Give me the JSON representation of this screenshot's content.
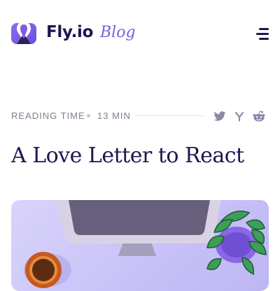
{
  "header": {
    "brand": "Fly.io",
    "section": "Blog",
    "logo_icon": "balloon-logo-icon",
    "menu_icon": "hamburger-menu-icon"
  },
  "meta": {
    "reading_label": "READING TIME",
    "reading_value": "13 MIN",
    "share_icons": [
      "twitter-icon",
      "hacker-news-icon",
      "reddit-icon"
    ]
  },
  "article": {
    "title": "A Love Letter to React"
  },
  "colors": {
    "brand_text": "#1b1750",
    "accent": "#7c5fe0",
    "muted": "#7e7f92",
    "hero_bg": "#cdc7fa"
  }
}
